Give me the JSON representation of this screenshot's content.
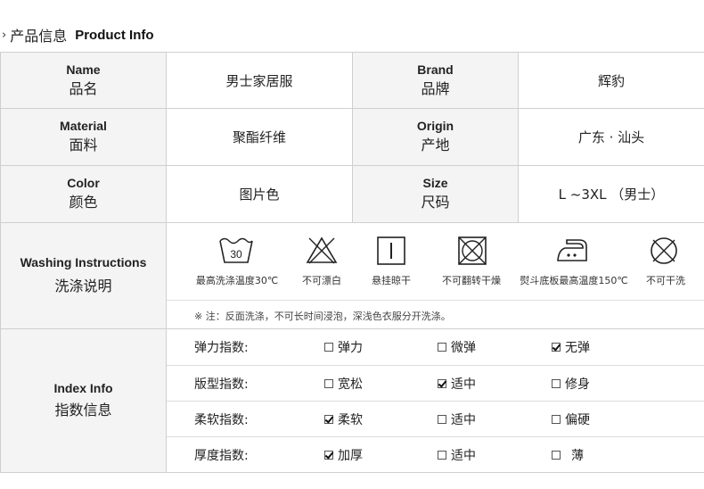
{
  "header": {
    "chevron": "›",
    "title_cn": "产品信息",
    "title_en": "Product Info"
  },
  "rows": [
    {
      "l1_en": "Name",
      "l1_cn": "品名",
      "v1": "男士家居服",
      "l2_en": "Brand",
      "l2_cn": "品牌",
      "v2": "辉豹"
    },
    {
      "l1_en": "Material",
      "l1_cn": "面料",
      "v1": "聚酯纤维",
      "l2_en": "Origin",
      "l2_cn": "产地",
      "v2": "广东 · 汕头"
    },
    {
      "l1_en": "Color",
      "l1_cn": "颜色",
      "v1": "图片色",
      "l2_en": "Size",
      "l2_cn": "尺码",
      "v2": "L ~3XL （男士）"
    }
  ],
  "washing": {
    "label_en": "Washing Instructions",
    "label_cn": "洗涤说明",
    "symbols": [
      {
        "icon": "wash-30-icon",
        "temp": "30",
        "caption": "最高洗涤温度30℃"
      },
      {
        "icon": "no-bleach-icon",
        "caption": "不可漂白"
      },
      {
        "icon": "hang-dry-icon",
        "caption": "悬挂晾干"
      },
      {
        "icon": "no-tumble-dry-icon",
        "caption": "不可翻转干燥"
      },
      {
        "icon": "iron-medium-icon",
        "caption": "熨斗底板最高温度150℃"
      },
      {
        "icon": "no-dry-clean-icon",
        "caption": "不可干洗"
      }
    ],
    "note": "※ 注：反面洗涤，不可长时间浸泡，深浅色衣服分开洗涤。"
  },
  "index": {
    "label_en": "Index Info",
    "label_cn": "指数信息",
    "rows": [
      {
        "name": "弹力指数:",
        "options": [
          {
            "label": "弹力",
            "checked": false
          },
          {
            "label": "微弹",
            "checked": false
          },
          {
            "label": "无弹",
            "checked": true
          }
        ]
      },
      {
        "name": "版型指数:",
        "options": [
          {
            "label": "宽松",
            "checked": false
          },
          {
            "label": "适中",
            "checked": true
          },
          {
            "label": "修身",
            "checked": false
          }
        ]
      },
      {
        "name": "柔软指数:",
        "options": [
          {
            "label": "柔软",
            "checked": true
          },
          {
            "label": "适中",
            "checked": false
          },
          {
            "label": "偏硬",
            "checked": false
          }
        ]
      },
      {
        "name": "厚度指数:",
        "options": [
          {
            "label": "加厚",
            "checked": true
          },
          {
            "label": "适中",
            "checked": false
          },
          {
            "label": "薄",
            "checked": false
          }
        ]
      }
    ]
  },
  "colors": {
    "label_bg": "#f4f4f4",
    "border": "#cfcfcf",
    "text": "#222222"
  }
}
